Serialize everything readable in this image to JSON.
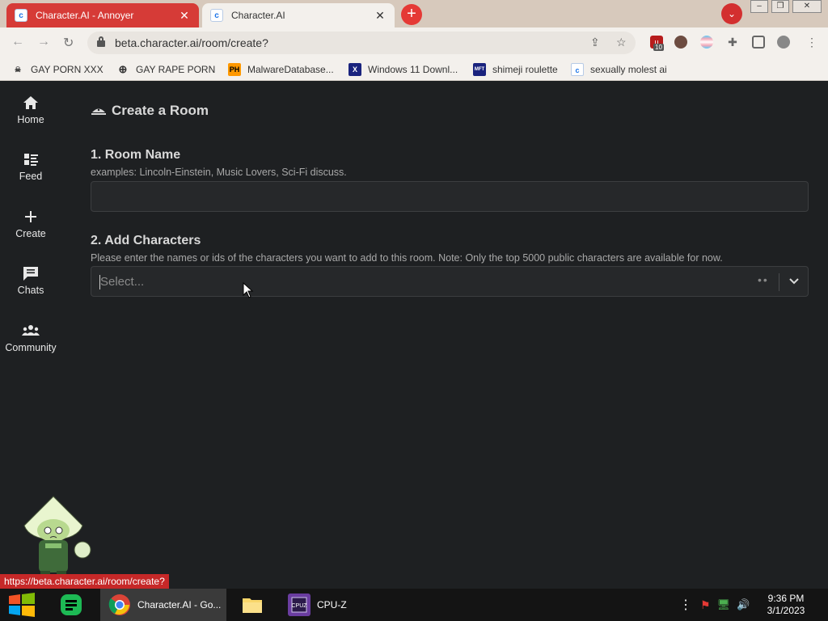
{
  "browser": {
    "tabs": [
      {
        "title": "Character.AI - Annoyer",
        "favicon": "c.ai-favicon",
        "active": false
      },
      {
        "title": "Character.AI",
        "favicon": "c.ai-favicon",
        "active": true
      }
    ],
    "url": "beta.character.ai/room/create?",
    "extension_badge": "10",
    "bookmarks": [
      {
        "label": "GAY PORN XXX",
        "icon": "skull-icon"
      },
      {
        "label": "GAY RAPE PORN",
        "icon": "globe-icon"
      },
      {
        "label": "MalwareDatabase...",
        "icon": "ph-icon",
        "icon_text": "PH"
      },
      {
        "label": "Windows 11 Downl...",
        "icon": "x-icon",
        "icon_text": "X"
      },
      {
        "label": "shimeji roulette",
        "icon": "mft-icon",
        "icon_text": "MFT"
      },
      {
        "label": "sexually molest ai",
        "icon": "c.ai-favicon"
      }
    ]
  },
  "sidebar": {
    "items": [
      {
        "label": "Home",
        "icon": "home-icon"
      },
      {
        "label": "Feed",
        "icon": "feed-icon"
      },
      {
        "label": "Create",
        "icon": "plus-icon"
      },
      {
        "label": "Chats",
        "icon": "chat-icon"
      },
      {
        "label": "Community",
        "icon": "community-icon"
      }
    ]
  },
  "main": {
    "title": "Create a Room",
    "room_name": {
      "label": "1. Room Name",
      "hint": "examples: Lincoln-Einstein, Music Lovers, Sci-Fi discuss.",
      "value": ""
    },
    "add_characters": {
      "label": "2. Add Characters",
      "hint": "Please enter the names or ids of the characters you want to add to this room. Note: Only the top 5000 public characters are available for now.",
      "placeholder": "Select..."
    }
  },
  "status_bar": {
    "url": "https://beta.character.ai/room/create?"
  },
  "taskbar": {
    "apps": [
      {
        "label": "",
        "icon": "sheets-icon"
      },
      {
        "label": "Character.AI - Go...",
        "icon": "chrome-icon"
      },
      {
        "label": "",
        "icon": "folder-icon"
      },
      {
        "label": "CPU-Z",
        "icon": "cpuz-icon"
      }
    ],
    "clock": {
      "time": "9:36 PM",
      "date": "3/1/2023"
    }
  },
  "colors": {
    "page_bg": "#1e2022",
    "tab_annoyer": "#d63b37",
    "accent_red": "#e53935"
  }
}
